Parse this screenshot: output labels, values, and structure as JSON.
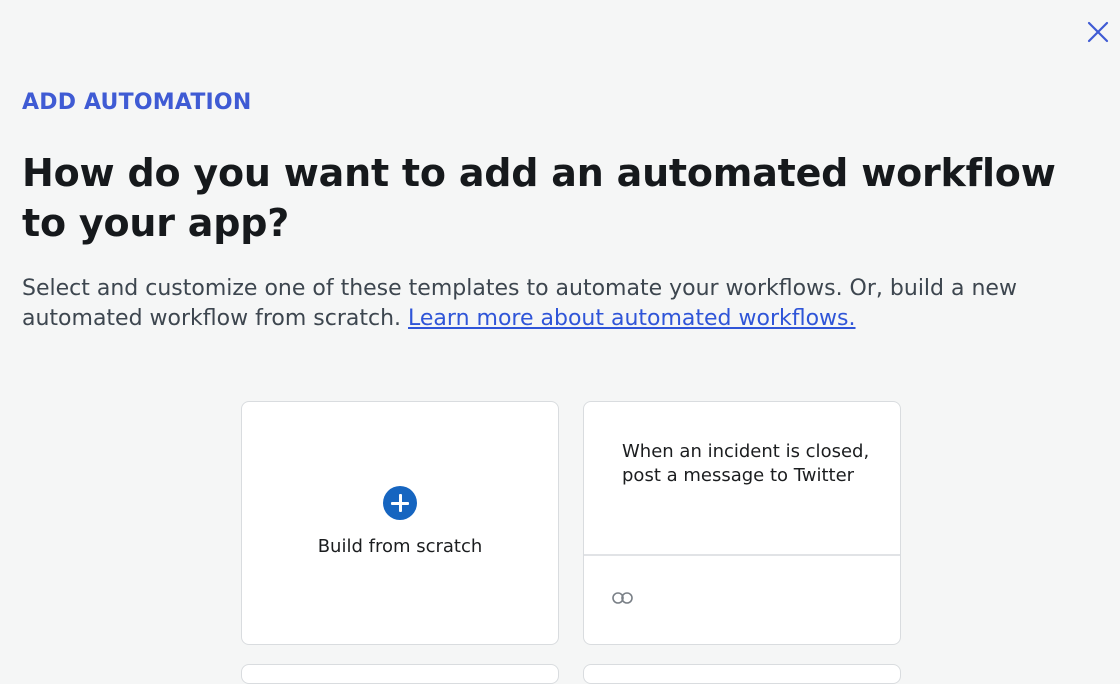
{
  "header": {
    "eyebrow": "ADD AUTOMATION",
    "title": "How do you want to add an automated workflow to your app?",
    "description": "Select and customize one of these templates to automate your workflows. Or, build a new automated workflow from scratch.",
    "learn_more_link": "Learn more about automated workflows."
  },
  "close": {
    "icon": "close-icon",
    "color": "#3f5bd4"
  },
  "cards": [
    {
      "type": "scratch",
      "icon": "plus-circle-icon",
      "label": "Build from scratch"
    },
    {
      "type": "template",
      "title": "When an incident is closed, post a message to Twitter",
      "icon": "connector-icon"
    }
  ],
  "colors": {
    "accent": "#3f5bd4",
    "link": "#2f55d8",
    "plus": "#1665c0",
    "background": "#f5f6f6"
  }
}
